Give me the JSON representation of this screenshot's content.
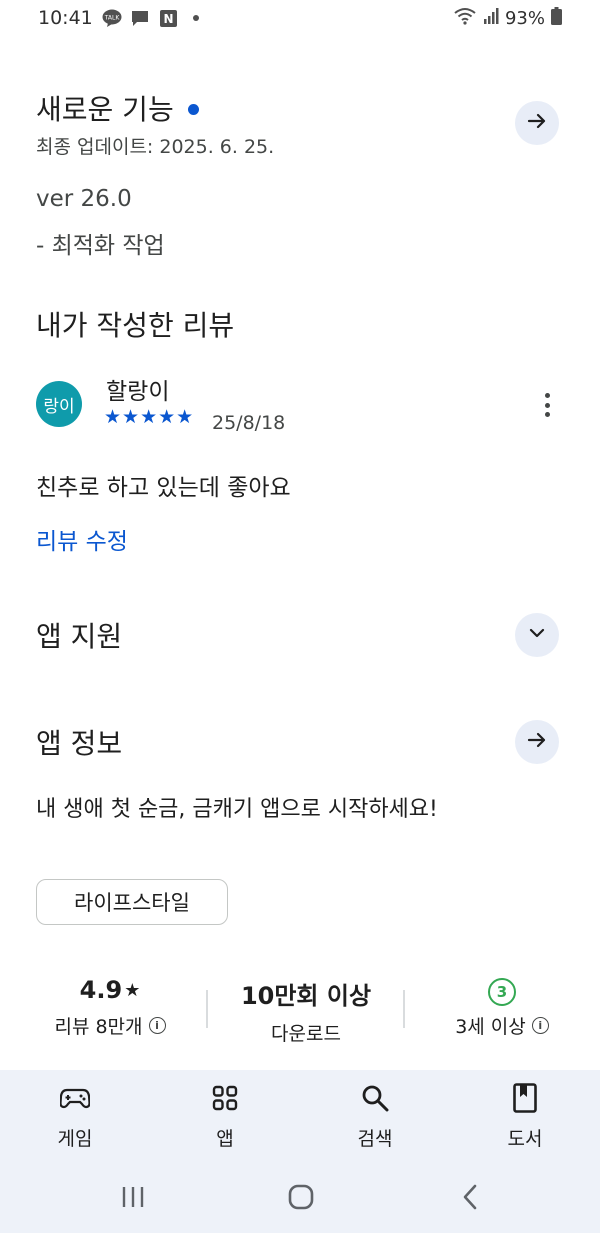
{
  "status_bar": {
    "time": "10:41",
    "notification_icons": [
      "kakaotalk-icon",
      "chat-icon",
      "naver-icon",
      "dot-icon"
    ],
    "kakao_label": "TALK",
    "naver_label": "N",
    "battery": "93%"
  },
  "whats_new": {
    "title": "새로운 기능",
    "updated": "최종 업데이트: 2025. 6. 25.",
    "version": "ver 26.0",
    "note": "- 최적화 작업"
  },
  "my_review": {
    "title": "내가 작성한 리뷰",
    "avatar_text": "랑이",
    "reviewer": "할랑이",
    "stars": "★★★★★",
    "rating": 5,
    "date": "25/8/18",
    "text": "친추로 하고 있는데 좋아요",
    "edit_label": "리뷰 수정"
  },
  "app_support": {
    "title": "앱 지원"
  },
  "app_info": {
    "title": "앱 정보",
    "description": "내 생애 첫 순금, 금캐기 앱으로 시작하세요!",
    "category": "라이프스타일"
  },
  "stats": {
    "rating_value": "4.9",
    "rating_star": "★",
    "reviews_label": "리뷰 8만개",
    "downloads_value": "10만회 이상",
    "downloads_label": "다운로드",
    "age_badge": "3",
    "age_label": "3세 이상"
  },
  "bottom_nav": {
    "items": [
      {
        "label": "게임",
        "icon": "gamepad-icon"
      },
      {
        "label": "앱",
        "icon": "apps-grid-icon"
      },
      {
        "label": "검색",
        "icon": "search-icon"
      },
      {
        "label": "도서",
        "icon": "book-icon"
      }
    ]
  },
  "colors": {
    "accent": "#0b57d0",
    "nav_background": "#eef2f9",
    "avatar": "#0f9bab",
    "age_badge": "#34a853"
  }
}
